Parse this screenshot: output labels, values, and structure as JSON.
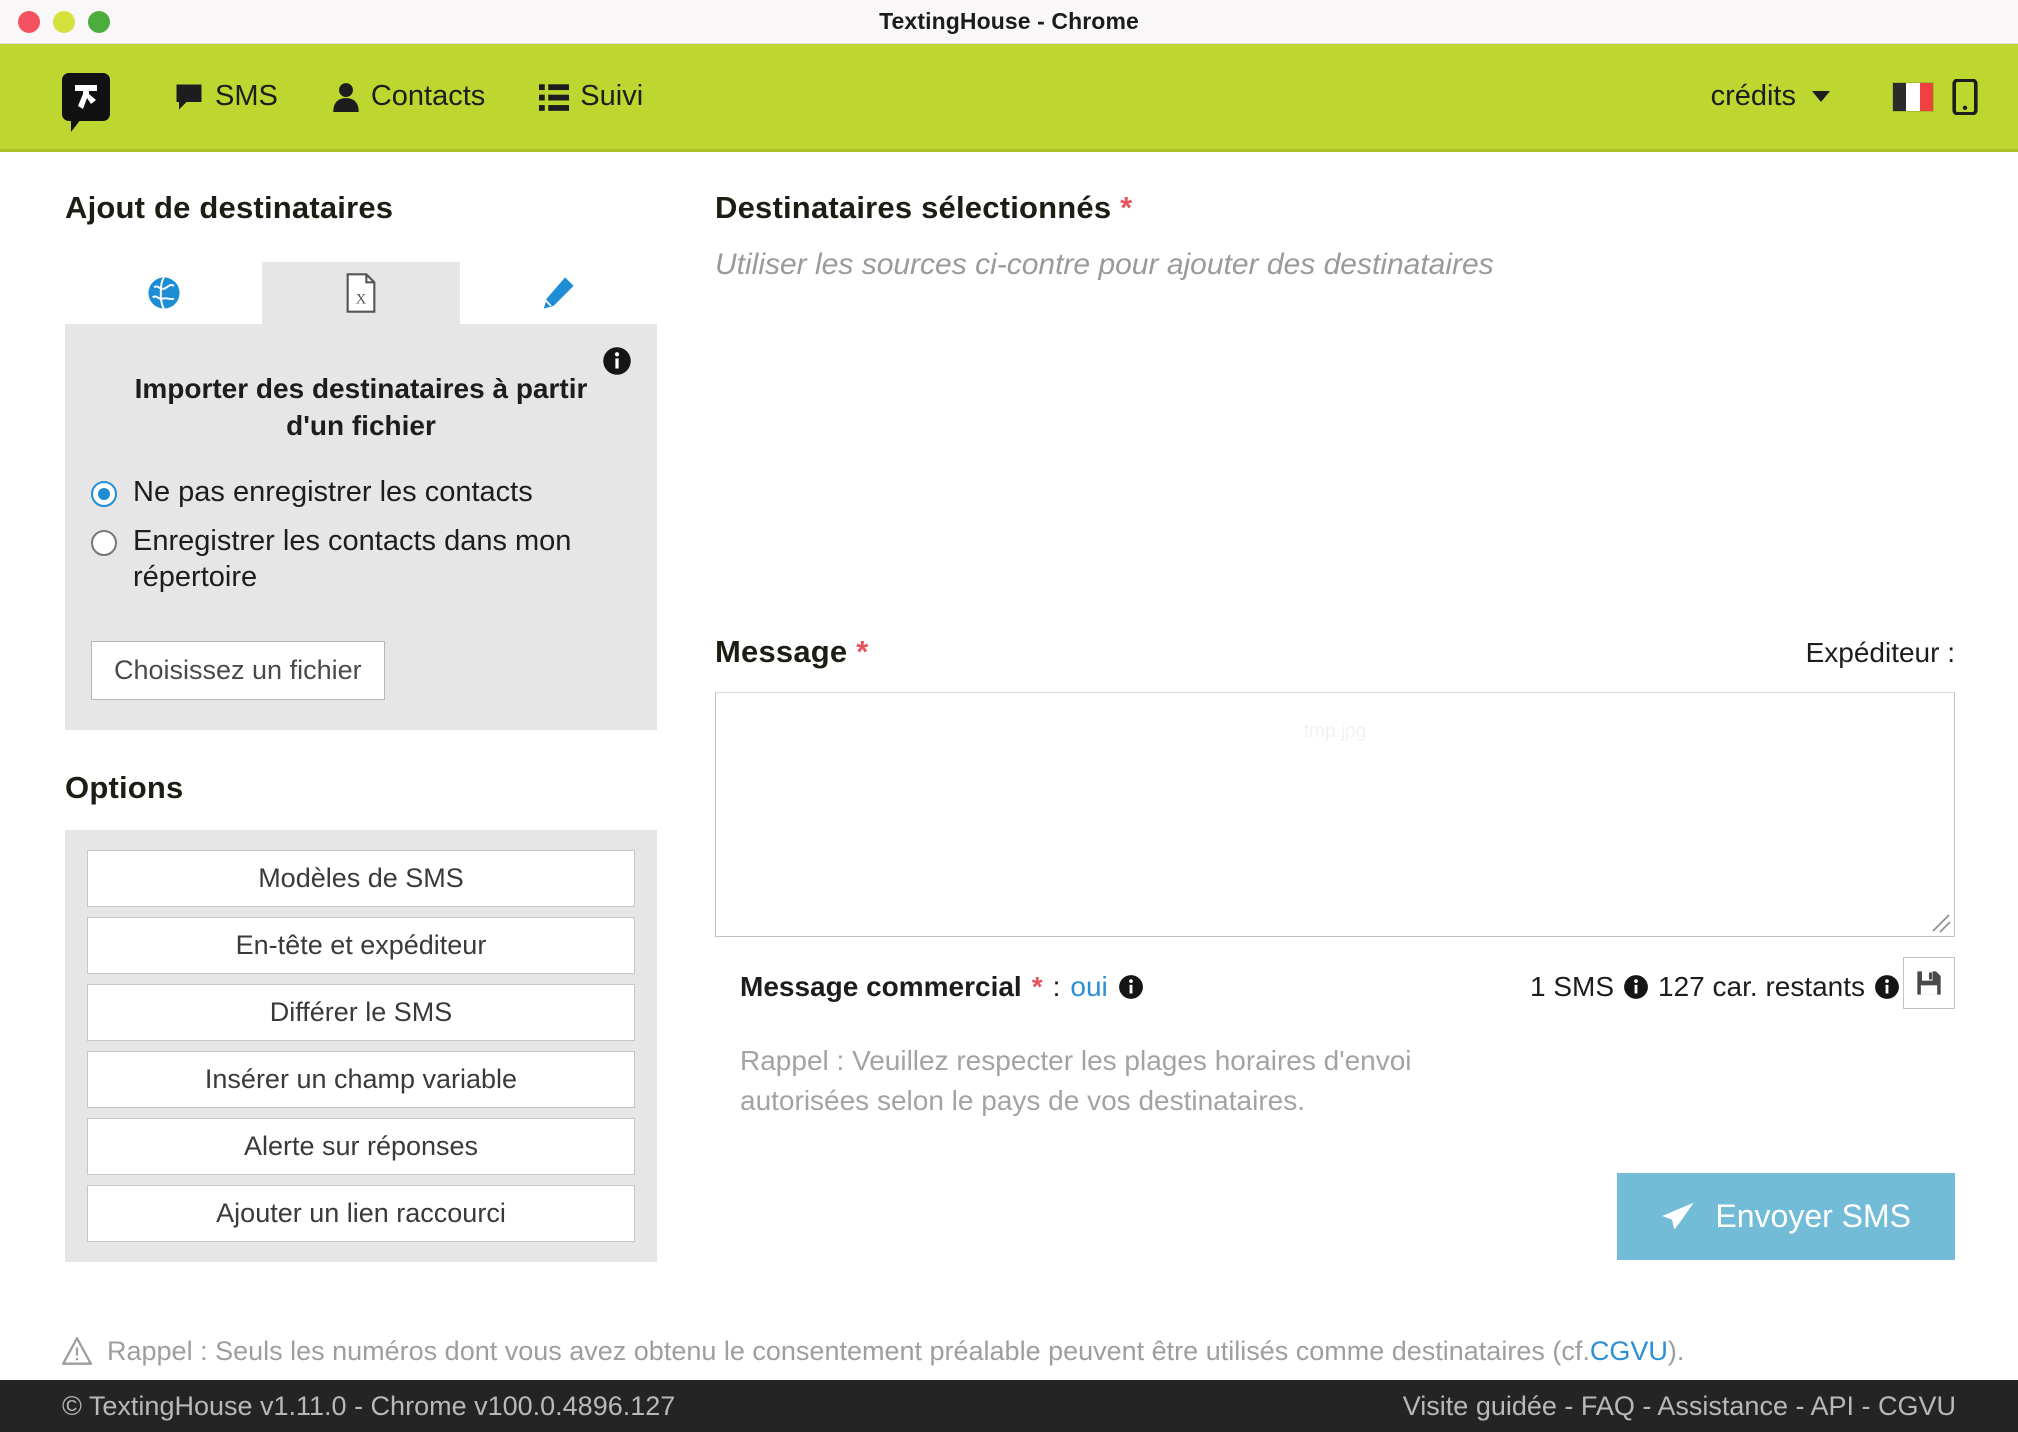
{
  "window": {
    "title": "TextingHouse - Chrome",
    "controls": [
      "close",
      "minimize",
      "zoom"
    ]
  },
  "navbar": {
    "brand_color": "#bed630",
    "logo_name": "textinghouse-logo",
    "items": [
      {
        "label": "SMS",
        "icon": "comment-icon"
      },
      {
        "label": "Contacts",
        "icon": "user-icon"
      },
      {
        "label": "Suivi",
        "icon": "list-icon"
      }
    ],
    "credits_label": "crédits",
    "flag": "fr-flag-icon",
    "mobile": "mobile-icon"
  },
  "recipients": {
    "heading": "Ajout de destinataires",
    "tabs": [
      {
        "name": "globe",
        "icon": "globe-icon",
        "active": false
      },
      {
        "name": "file-excel",
        "icon": "file-excel-icon",
        "active": true
      },
      {
        "name": "manual",
        "icon": "pencil-icon",
        "active": false
      }
    ],
    "import": {
      "title": "Importer des destinataires à partir d'un fichier",
      "info_icon": "info-circle-icon",
      "radios": [
        {
          "label": "Ne pas enregistrer les contacts",
          "checked": true
        },
        {
          "label": "Enregistrer les contacts dans mon répertoire",
          "checked": false
        }
      ],
      "file_button": "Choisissez un fichier"
    }
  },
  "options": {
    "heading": "Options",
    "buttons": [
      "Modèles de SMS",
      "En-tête et expéditeur",
      "Différer le SMS",
      "Insérer un champ variable",
      "Alerte sur réponses",
      "Ajouter un lien raccourci"
    ]
  },
  "selected": {
    "heading": "Destinataires sélectionnés",
    "required_mark": "*",
    "empty_hint": "Utiliser les sources ci-contre pour ajouter des destinataires"
  },
  "message": {
    "heading": "Message",
    "required_mark": "*",
    "sender_label": "Expéditeur :",
    "textarea_value": "",
    "textarea_ghost": "tmp.jpg",
    "commercial_label": "Message commercial",
    "commercial_sep": ":",
    "commercial_value": "oui",
    "commercial_info_icon": "info-circle-icon",
    "sms_count": "1 SMS",
    "sms_info_icon": "info-circle-icon",
    "chars_left": "127 car. restants",
    "chars_info_icon": "info-circle-icon",
    "save_icon": "floppy-disk-icon",
    "recall": "Rappel : Veuillez respecter les plages horaires d'envoi autorisées selon le pays de vos destinataires.",
    "send_label": "Envoyer SMS",
    "send_icon": "paper-plane-icon",
    "send_color": "#72bcd8"
  },
  "notice": {
    "icon": "warning-triangle-icon",
    "text_before": "Rappel : Seuls les numéros dont vous avez obtenu le consentement préalable peuvent être utilisés comme destinataires (cf. ",
    "link": "CGVU",
    "text_after": ")."
  },
  "footer": {
    "left": "© TextingHouse v1.11.0 - Chrome v100.0.4896.127",
    "right": "Visite guidée - FAQ - Assistance - API - CGVU"
  }
}
